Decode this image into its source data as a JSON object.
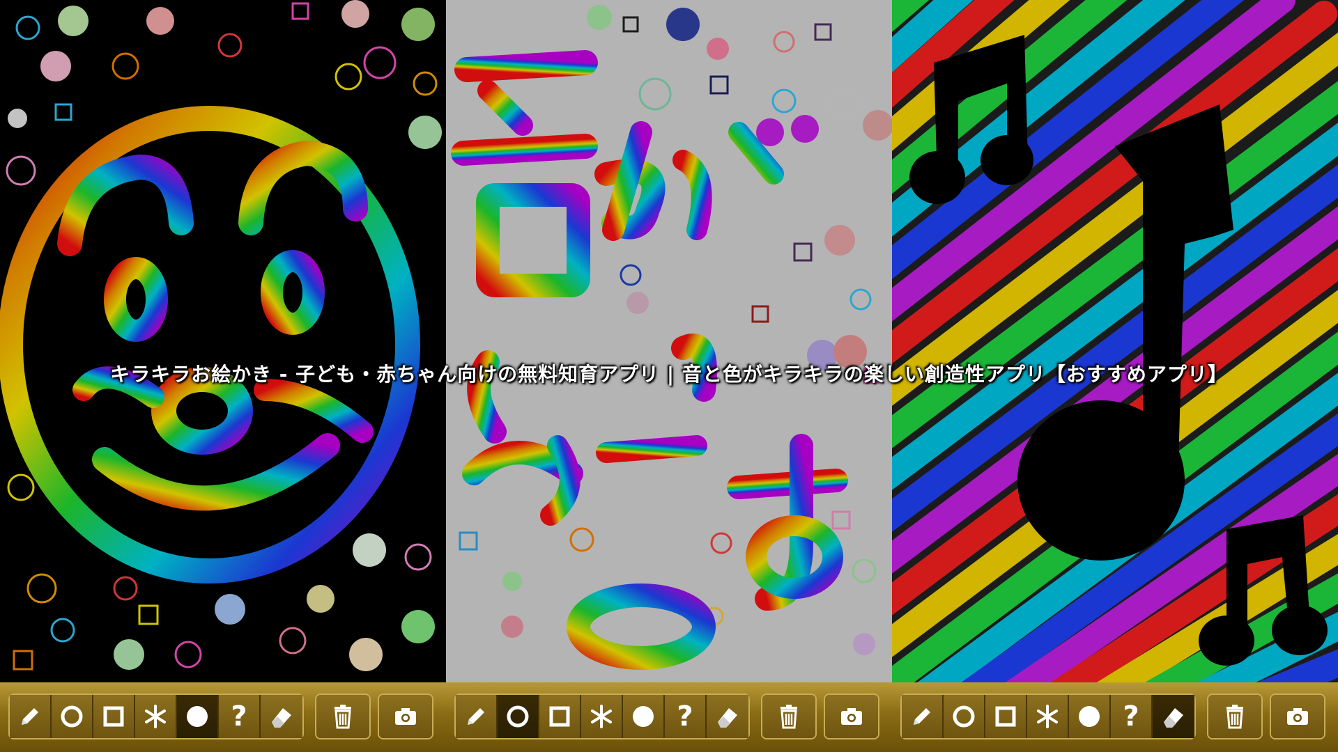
{
  "headline": "キラキラお絵かき - 子ども・赤ちゃん向けの無料知育アプリ | 音と色がキラキラの楽しい創造性アプリ【おすすめアプリ】",
  "panels": [
    {
      "name": "panel-face-drawing",
      "background": "#000000"
    },
    {
      "name": "panel-text-drawing",
      "background": "#dcdcdc"
    },
    {
      "name": "panel-music-notes-drawing",
      "background": "#222222"
    }
  ],
  "toolbar": {
    "tools": [
      "pen-icon",
      "circle-stamp-icon",
      "square-stamp-icon",
      "star-stamp-icon",
      "dot-stamp-icon",
      "random-stamp-icon",
      "eraser-icon"
    ],
    "question_label": "?",
    "active_tool": {
      "toolbar_1": "dot-stamp-icon",
      "toolbar_2": "circle-stamp-icon",
      "toolbar_3": "eraser-icon"
    },
    "extra_buttons": [
      "trash-icon",
      "camera-icon"
    ]
  },
  "colors": {
    "toolbar_gold": "#9a7c22",
    "rainbow": [
      "#ff0000",
      "#ff8800",
      "#ffee00",
      "#22dd22",
      "#00ddee",
      "#2244ff",
      "#cc00ee"
    ]
  }
}
